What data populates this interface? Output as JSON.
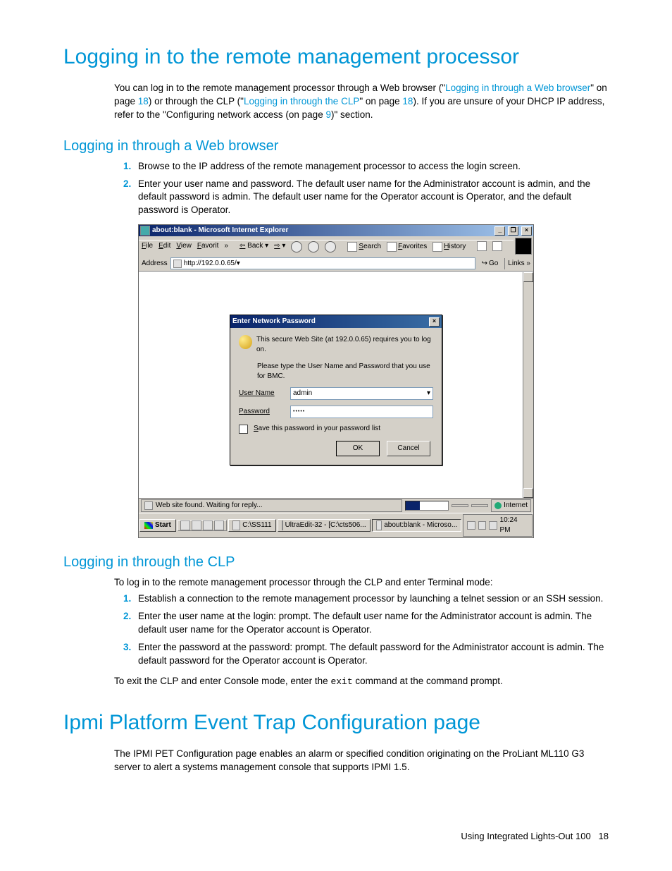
{
  "h1_a": "Logging in to the remote management processor",
  "intro_a_pre": "You can log in to the remote management processor through a Web browser (\"",
  "intro_a_link1": "Logging in through a Web browser",
  "intro_a_mid1": "\" on page ",
  "intro_a_page1": "18",
  "intro_a_mid2": ") or through the CLP (\"",
  "intro_a_link2": "Logging in through the CLP",
  "intro_a_mid3": "\" on page ",
  "intro_a_page2": "18",
  "intro_a_mid4": "). If you are unsure of your DHCP IP address, refer to the \"Configuring network access (on page ",
  "intro_a_page3": "9",
  "intro_a_end": ")\" section.",
  "h2_web": "Logging in through a Web browser",
  "web_steps": [
    "Browse to the IP address of the remote management processor to access the login screen.",
    "Enter your user name and password. The default user name for the Administrator account is admin, and the default password is admin. The default user name for the Operator account is Operator, and the default password is Operator."
  ],
  "ie": {
    "title": "about:blank - Microsoft Internet Explorer",
    "menus": [
      "File",
      "Edit",
      "View",
      "Favorit"
    ],
    "back": "Back",
    "tb_search": "Search",
    "tb_fav": "Favorites",
    "tb_hist": "History",
    "addr_label": "Address",
    "addr_value": "http://192.0.0.65/",
    "go": "Go",
    "links": "Links",
    "status": "Web site found. Waiting for reply...",
    "zone": "Internet"
  },
  "auth": {
    "title": "Enter Network Password",
    "line1": "This secure Web Site (at 192.0.0.65) requires you to log on.",
    "line2": "Please type the User Name and Password that you use for BMC.",
    "user_label_u": "U",
    "user_label_rest": "ser Name",
    "pass_label_u": "P",
    "pass_label_rest": "assword",
    "user_val": "admin",
    "pass_val": "•••••",
    "save_u": "S",
    "save_rest": "ave this password in your password list",
    "ok": "OK",
    "cancel": "Cancel"
  },
  "taskbar": {
    "start": "Start",
    "path": "C:\\SS111",
    "task1": "UltraEdit-32 - [C:\\cts506...",
    "task2": "about:blank - Microso...",
    "time": "10:24 PM"
  },
  "h2_clp": "Logging in through the CLP",
  "clp_intro": "To log in to the remote management processor through the CLP and enter Terminal mode:",
  "clp_steps": [
    "Establish a connection to the remote management processor by launching a telnet session or an SSH session.",
    "Enter the user name at the login: prompt. The default user name for the Administrator account is admin. The default user name for the Operator account is Operator.",
    "Enter the password at the password: prompt. The default password for the Administrator account is admin. The default password for the Operator account is Operator."
  ],
  "clp_exit_pre": "To exit the CLP and enter Console mode, enter the ",
  "clp_exit_code": "exit",
  "clp_exit_post": " command at the command prompt.",
  "h1_b": "Ipmi Platform Event Trap Configuration page",
  "ipmi_text": "The IPMI PET Configuration page enables an alarm or specified condition originating on the ProLiant ML110 G3 server to alert a systems management console that supports IPMI 1.5.",
  "footer_text": "Using Integrated Lights-Out 100",
  "footer_page": "18"
}
